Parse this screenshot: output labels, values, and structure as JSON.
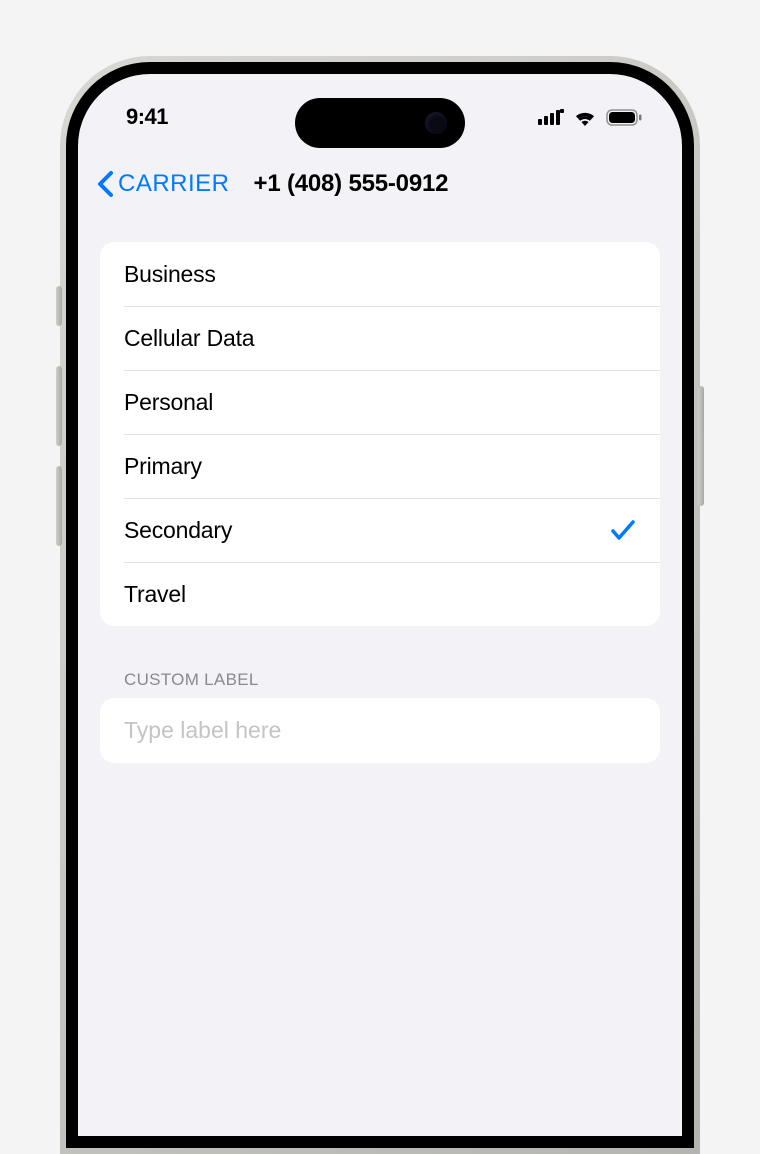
{
  "status": {
    "time": "9:41"
  },
  "nav": {
    "back_label": "CARRIER",
    "title": "+1 (408) 555-0912"
  },
  "labels": [
    {
      "text": "Business",
      "selected": false
    },
    {
      "text": "Cellular Data",
      "selected": false
    },
    {
      "text": "Personal",
      "selected": false
    },
    {
      "text": "Primary",
      "selected": false
    },
    {
      "text": "Secondary",
      "selected": true
    },
    {
      "text": "Travel",
      "selected": false
    }
  ],
  "custom": {
    "header": "CUSTOM LABEL",
    "placeholder": "Type label here",
    "value": ""
  }
}
